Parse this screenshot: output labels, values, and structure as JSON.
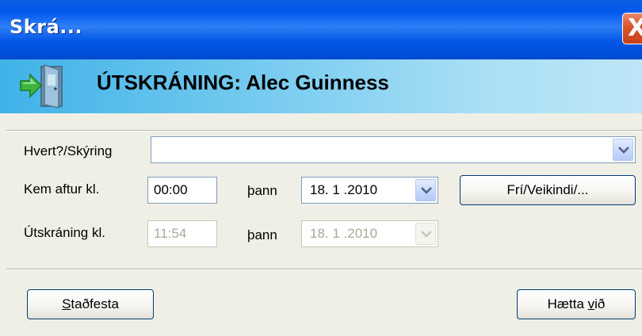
{
  "window": {
    "title": "Skrá..."
  },
  "titlebar": {
    "close_glyph": "X",
    "close_icon": "close-icon"
  },
  "header": {
    "icon": "door-exit-icon",
    "title": "ÚTSKRÁNING: Alec Guinness"
  },
  "form": {
    "reason": {
      "label": "Hvert?/Skýring",
      "value": ""
    },
    "return": {
      "label": "Kem aftur kl.",
      "time": "00:00",
      "date_label": "þann",
      "date": "18. 1 .2010"
    },
    "checkout": {
      "label": "Útskráning kl.",
      "time": "11:54",
      "date_label": "þann",
      "date": "18. 1 .2010"
    },
    "leave_button": "Frí/Veikindi/..."
  },
  "footer": {
    "confirm": {
      "mnemonic": "S",
      "rest": "taðfesta"
    },
    "cancel": {
      "prefix": "Hætta ",
      "mnemonic": "v",
      "rest": "ið"
    }
  },
  "colors": {
    "titlebar": "#0058ee",
    "header": "#7ccdf0",
    "body": "#f0efe6",
    "close": "#d8532a"
  }
}
